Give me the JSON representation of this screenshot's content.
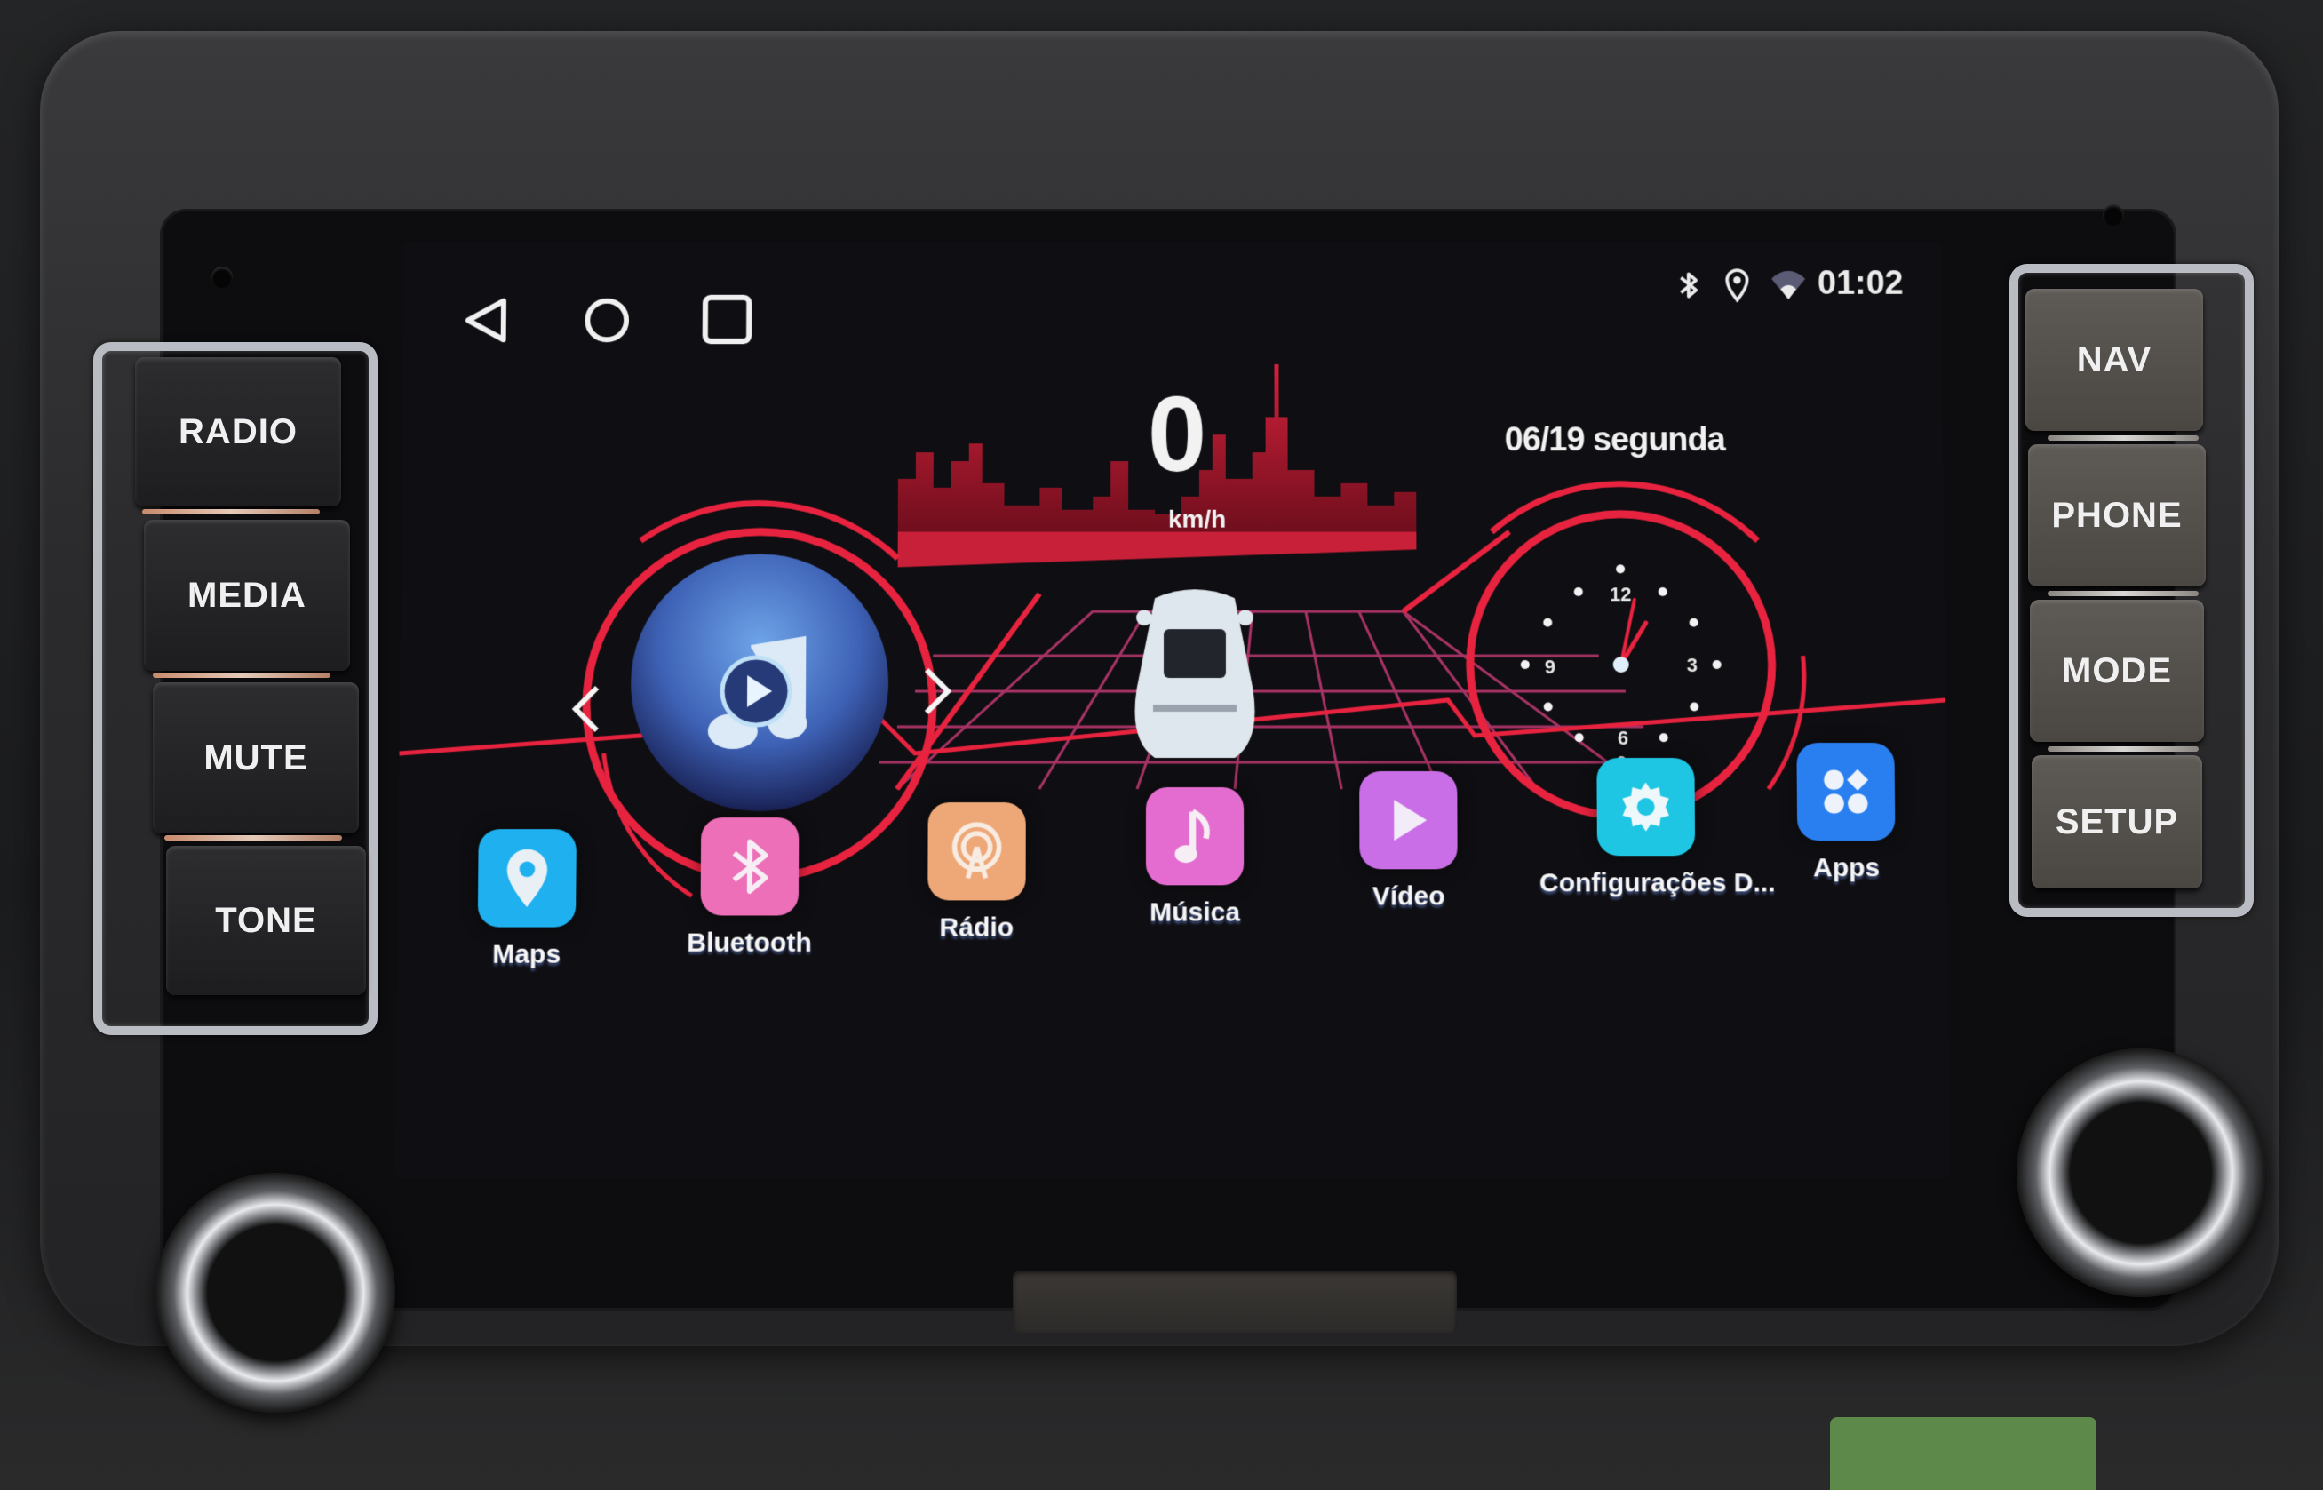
{
  "status_bar": {
    "time": "01:02",
    "icons": [
      "bluetooth-icon",
      "location-icon",
      "wifi-icon"
    ]
  },
  "nav_bar": {
    "buttons": [
      {
        "name": "back",
        "icon": "back-triangle-icon"
      },
      {
        "name": "home",
        "icon": "home-circle-icon"
      },
      {
        "name": "recents",
        "icon": "recents-square-icon"
      }
    ]
  },
  "dashboard": {
    "speed": "0",
    "speed_unit": "km/h",
    "date": "06/19 segunda",
    "clock": {
      "labels": [
        "12",
        "3",
        "6",
        "9"
      ],
      "hour": 1,
      "minute": 2
    },
    "music_widget": {
      "prev_icon": "chevron-left-icon",
      "next_icon": "chevron-right-icon",
      "center_icon": "music-play-icon"
    }
  },
  "apps": [
    {
      "label": "Maps",
      "icon": "map-pin-icon",
      "color": "#1fb0f0"
    },
    {
      "label": "Bluetooth",
      "icon": "bluetooth-icon",
      "color": "#ec6fb8"
    },
    {
      "label": "Rádio",
      "icon": "radio-tower-icon",
      "color": "#eea777"
    },
    {
      "label": "Música",
      "icon": "music-note-icon",
      "color": "#e46cd0"
    },
    {
      "label": "Vídeo",
      "icon": "play-icon",
      "color": "#c96ee6"
    },
    {
      "label": "Configurações D...",
      "icon": "gear-icon",
      "color": "#1ec6e4"
    },
    {
      "label": "Apps",
      "icon": "apps-grid-icon",
      "color": "#2a7ff0"
    }
  ],
  "hardware_buttons": {
    "left": [
      "RADIO",
      "MEDIA",
      "MUTE",
      "TONE"
    ],
    "right": [
      "NAV",
      "PHONE",
      "MODE",
      "SETUP"
    ]
  },
  "theme": {
    "accent": "#e8233f",
    "grid": "#c23a74"
  }
}
